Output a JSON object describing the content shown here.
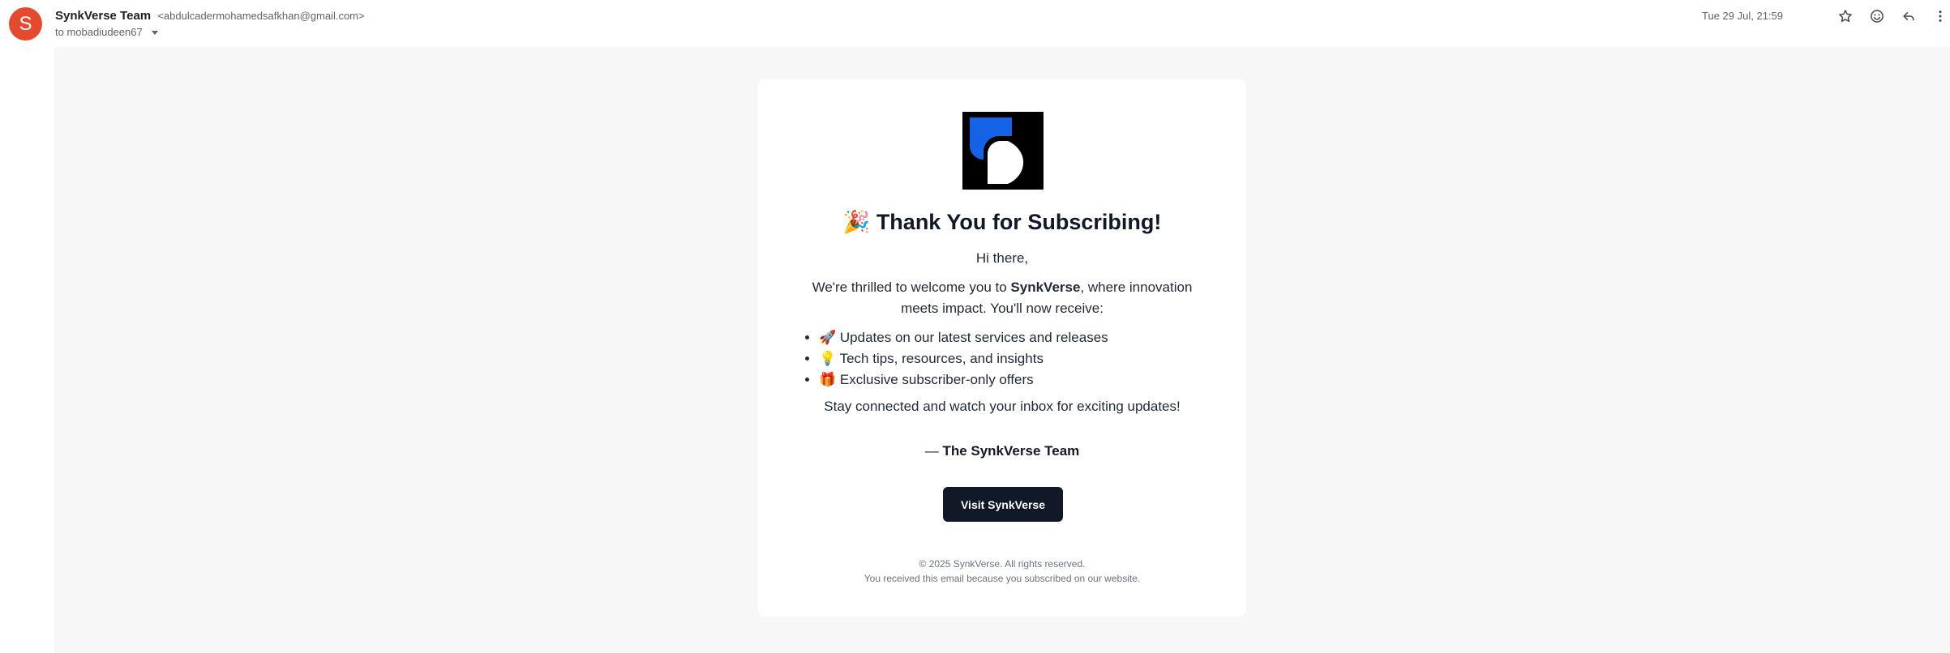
{
  "email": {
    "avatar_letter": "S",
    "sender_name": "SynkVerse Team",
    "sender_email": "<abdulcadermohamedsafkhan@gmail.com>",
    "recipient": "to mobadiudeen67",
    "date": "Tue 29 Jul, 21:59"
  },
  "header_icons": [
    "star-icon",
    "emoji-icon",
    "reply-icon",
    "more-vert-icon"
  ],
  "content": {
    "headline_emoji": "🎉",
    "headline": "Thank You for Subscribing!",
    "greeting": "Hi there,",
    "intro_before": "We're thrilled to welcome you to ",
    "intro_brand": "SynkVerse",
    "intro_after": ", where innovation meets impact. You'll now receive:",
    "benefits": [
      {
        "emoji": "🚀",
        "text": "Updates on our latest services and releases"
      },
      {
        "emoji": "💡",
        "text": "Tech tips, resources, and insights"
      },
      {
        "emoji": "🎁",
        "text": "Exclusive subscriber-only offers"
      }
    ],
    "outro": "Stay connected and watch your inbox for exciting updates!",
    "signature_dash": "— ",
    "signature": "The SynkVerse Team",
    "cta_label": "Visit SynkVerse",
    "footer_copyright": "© 2025 SynkVerse. All rights reserved.",
    "footer_reason": "You received this email because you subscribed on our website."
  },
  "colors": {
    "avatar": "#e64a2e",
    "logo_blue": "#1463e6",
    "cta_bg": "#111827",
    "page_bg": "#f7f7f7"
  }
}
